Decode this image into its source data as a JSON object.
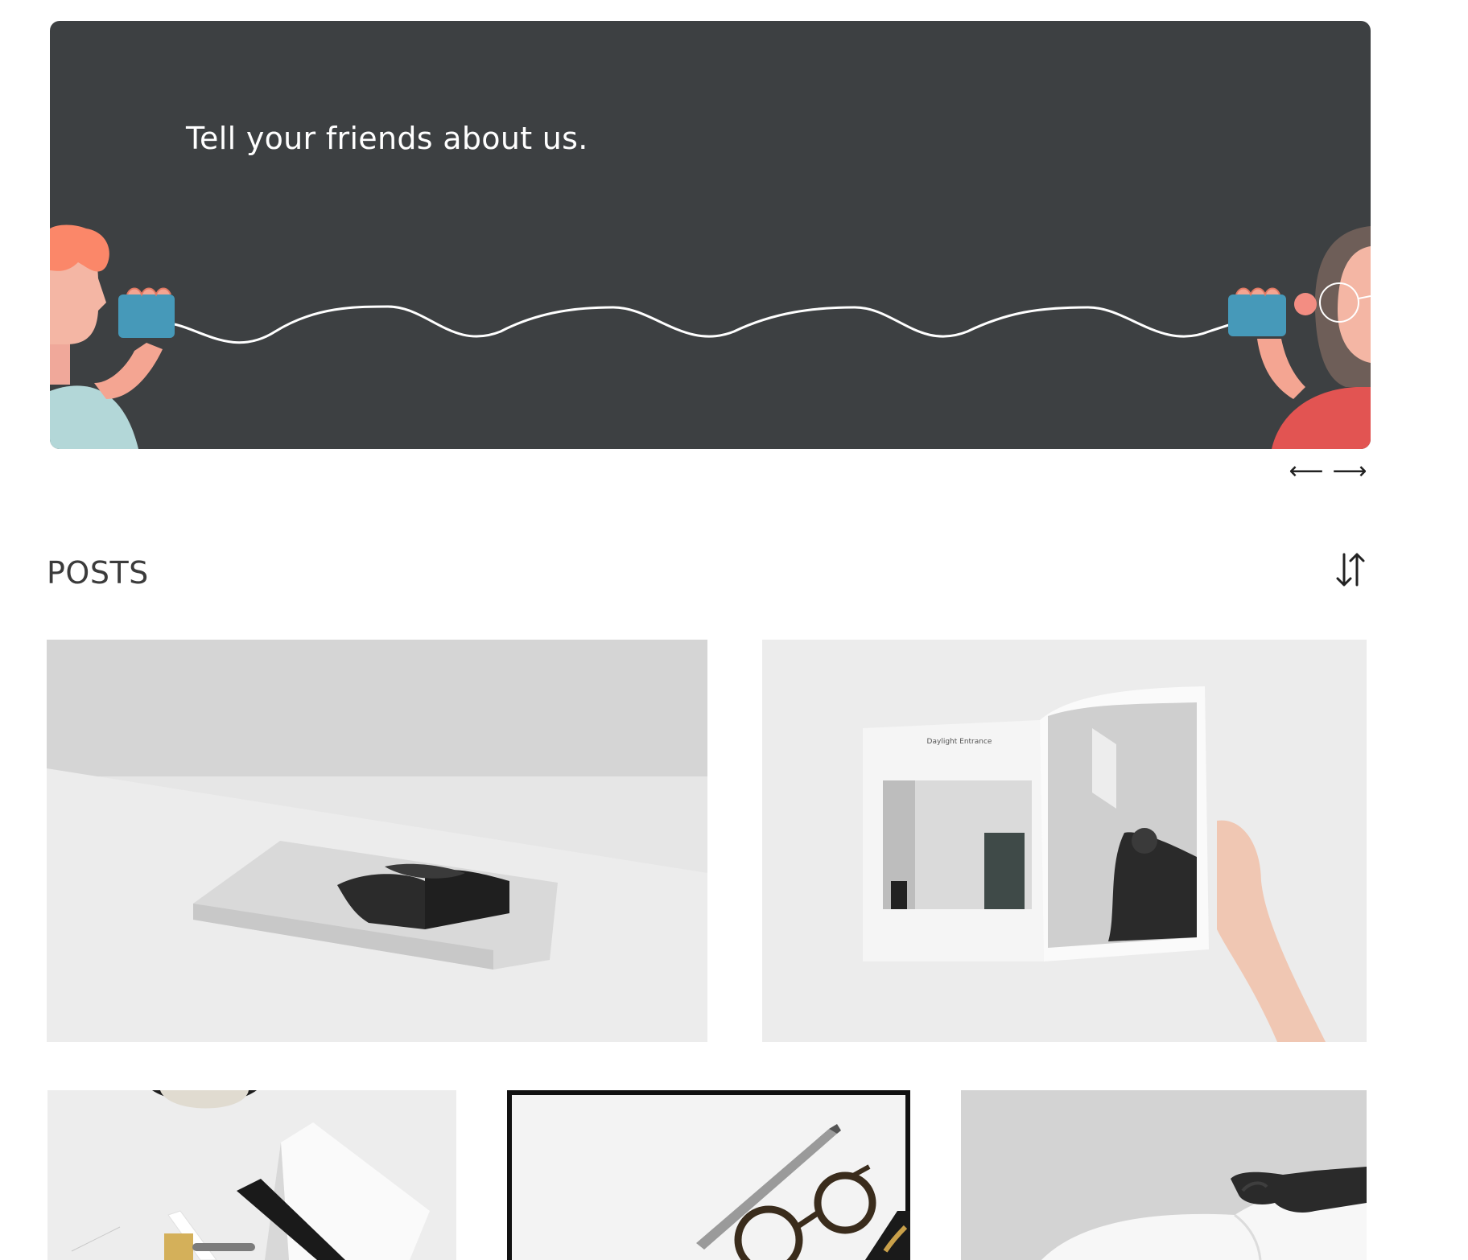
{
  "hero": {
    "title": "Tell your friends about us.",
    "background_color": "#3d4042"
  },
  "slider": {
    "prev_label": "⟵",
    "next_label": "⟶"
  },
  "posts_section": {
    "title": "POSTS",
    "sort_icon": "sort-arrows-icon"
  },
  "posts": [
    {
      "image": "magazine-on-white-table-photo"
    },
    {
      "image": "hand-holding-open-magazine-photo",
      "printed_text": [
        "Daylight Entrance"
      ]
    },
    {
      "image": "desk-stapler-ruler-photo"
    },
    {
      "image": "pen-and-glasses-photo"
    },
    {
      "image": "hand-with-open-book-photo"
    }
  ]
}
